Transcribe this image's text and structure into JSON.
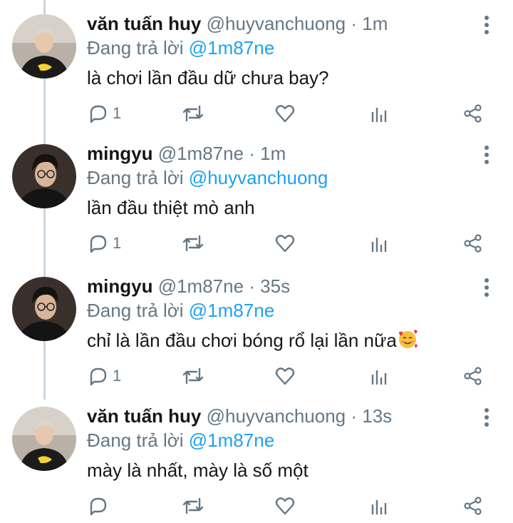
{
  "tweets": [
    {
      "name": "văn tuấn huy",
      "handle": "@huyvanchuong",
      "time": "· 1m",
      "reply_prefix": "Đang trả lời",
      "reply_to": "@1m87ne",
      "text": "là chơi lần đầu dữ chưa bay?",
      "reply_count": "1",
      "avatar": "person-yellow-tee"
    },
    {
      "name": "mingyu",
      "handle": "@1m87ne",
      "time": "· 1m",
      "reply_prefix": "Đang trả lời",
      "reply_to": "@huyvanchuong",
      "text": "lần đầu thiệt mò anh",
      "reply_count": "1",
      "avatar": "person-glasses"
    },
    {
      "name": "mingyu",
      "handle": "@1m87ne",
      "time": "· 35s",
      "reply_prefix": "Đang trả lời",
      "reply_to": "@1m87ne",
      "text": "chỉ là lần đầu chơi bóng rổ lại lần nữa",
      "emoji": "smiling-face-with-hearts",
      "reply_count": "1",
      "avatar": "person-glasses"
    },
    {
      "name": "văn tuấn huy",
      "handle": "@huyvanchuong",
      "time": "· 13s",
      "reply_prefix": "Đang trả lời",
      "reply_to": "@1m87ne",
      "text": "mày là nhất, mày là số một",
      "reply_count": "",
      "avatar": "person-yellow-tee"
    }
  ],
  "colors": {
    "text": "#14171a",
    "secondary": "#657786",
    "link": "#1da1f2",
    "thread": "#ccd6dd"
  },
  "icons": [
    "reply-icon",
    "retweet-icon",
    "like-icon",
    "analytics-icon",
    "share-icon",
    "more-icon"
  ]
}
